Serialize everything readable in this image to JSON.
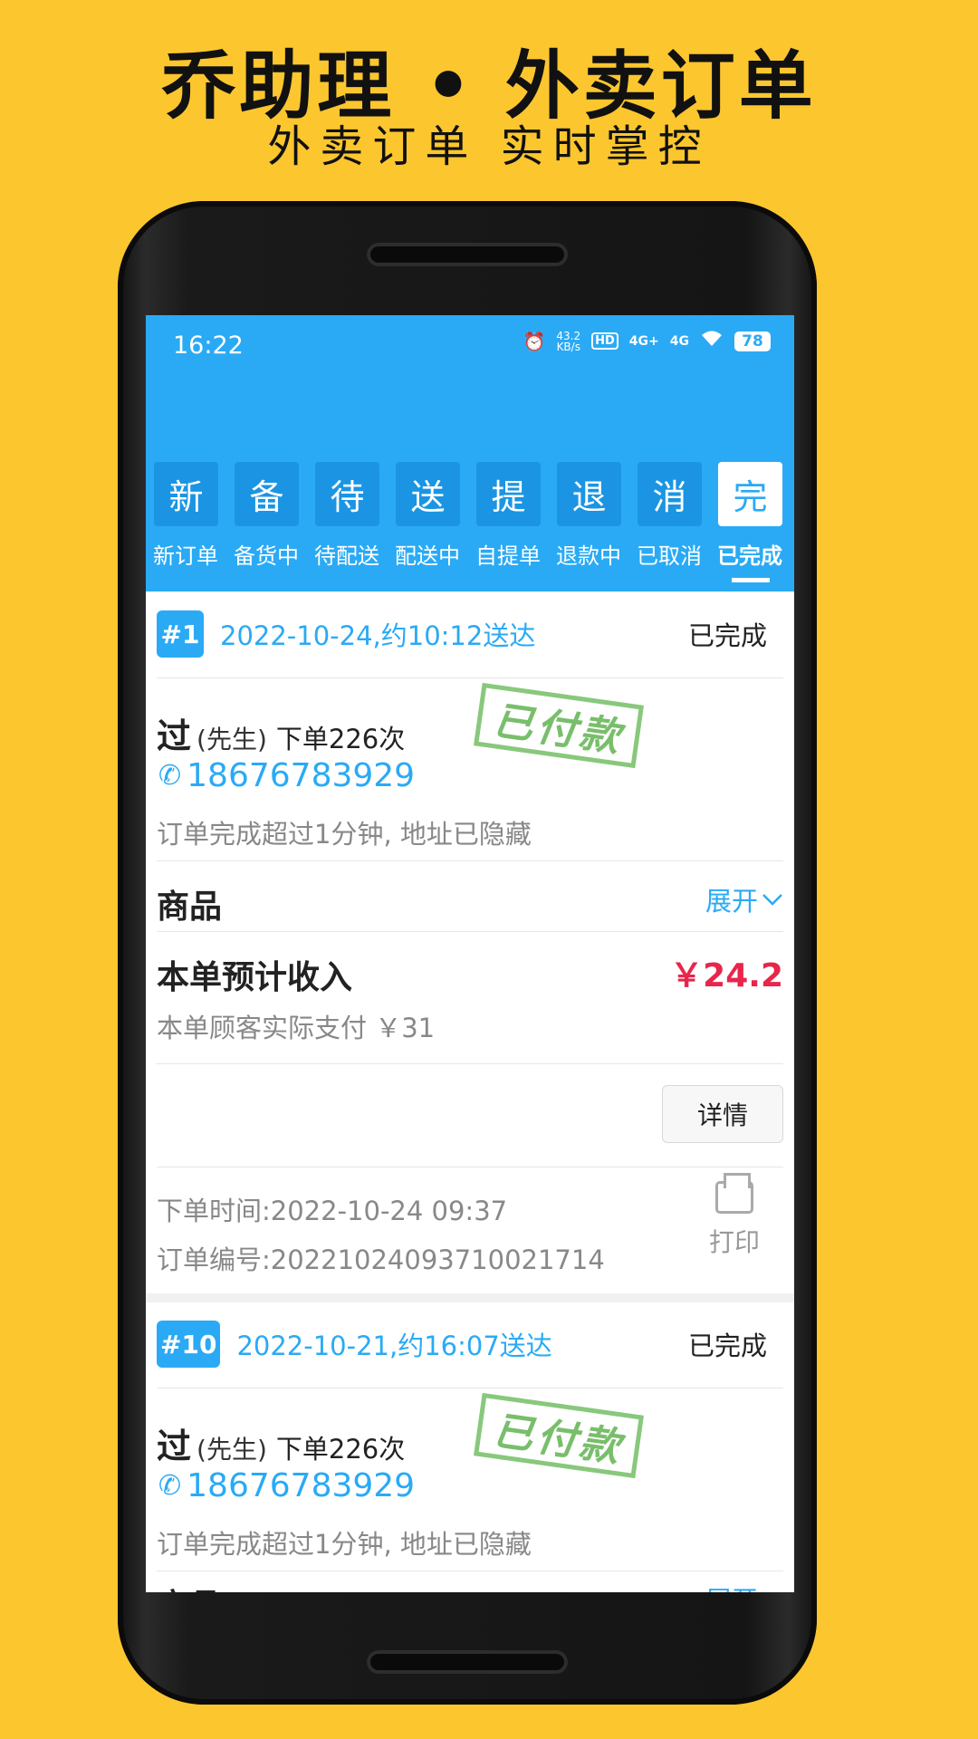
{
  "promo": {
    "title": "乔助理 • 外卖订单",
    "subtitle": "外卖订单 实时掌控"
  },
  "status_bar": {
    "time": "16:22",
    "net_speed_value": "43.2",
    "net_speed_unit": "KB/s",
    "hd": "HD",
    "signal1": "4G+",
    "signal2": "4G",
    "battery": "78",
    "icons": [
      "alarm-icon",
      "hd-icon",
      "signal-icon",
      "signal-icon",
      "wifi-icon",
      "battery-icon"
    ]
  },
  "tabs": [
    {
      "badge": "新",
      "label": "新订单",
      "active": false
    },
    {
      "badge": "备",
      "label": "备货中",
      "active": false
    },
    {
      "badge": "待",
      "label": "待配送",
      "active": false
    },
    {
      "badge": "送",
      "label": "配送中",
      "active": false
    },
    {
      "badge": "提",
      "label": "自提单",
      "active": false
    },
    {
      "badge": "退",
      "label": "退款中",
      "active": false
    },
    {
      "badge": "消",
      "label": "已取消",
      "active": false
    },
    {
      "badge": "完",
      "label": "已完成",
      "active": true
    }
  ],
  "orders": [
    {
      "number": "#1",
      "eta": "2022-10-24,约10:12送达",
      "status": "已完成",
      "customer_name": "过",
      "customer_title": "(先生)",
      "order_count": "下单226次",
      "phone": "18676783929",
      "stamp": "已付款",
      "address_note": "订单完成超过1分钟, 地址已隐藏",
      "goods_label": "商品",
      "expand_label": "展开",
      "income_label": "本单预计收入",
      "income_value": "￥24.2",
      "paid_note": "本单顾客实际支付 ￥31",
      "detail_label": "详情",
      "order_time": "下单时间:2022-10-24 09:37",
      "order_id": "订单编号:20221024093710021714",
      "print_label": "打印"
    },
    {
      "number": "#10",
      "eta": "2022-10-21,约16:07送达",
      "status": "已完成",
      "customer_name": "过",
      "customer_title": "(先生)",
      "order_count": "下单226次",
      "phone": "18676783929",
      "stamp": "已付款",
      "address_note": "订单完成超过1分钟, 地址已隐藏",
      "goods_label": "商品",
      "expand_label": "展开"
    }
  ],
  "colors": {
    "accent": "#2AAAF5",
    "background": "#FCC62E",
    "price": "#E8264B",
    "stamp": "#7CC36E"
  }
}
